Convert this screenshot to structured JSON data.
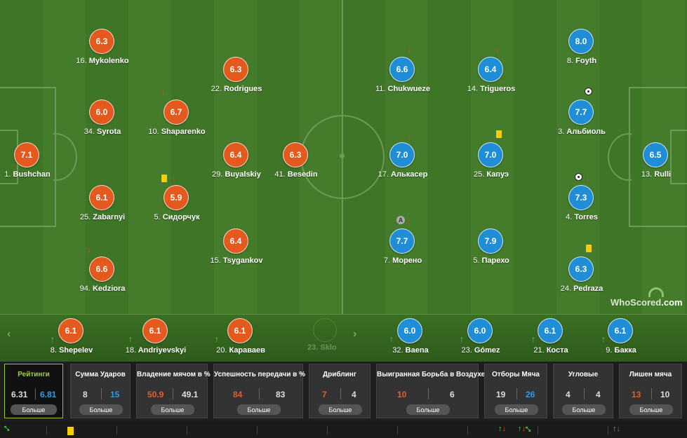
{
  "home_team": {
    "color": "#e4591d",
    "players": [
      {
        "rating": "6.3",
        "num": "16.",
        "name": "Mykolenko"
      },
      {
        "rating": "6.0",
        "num": "34.",
        "name": "Syrota"
      },
      {
        "rating": "6.1",
        "num": "25.",
        "name": "Zabarnyi"
      },
      {
        "rating": "6.6",
        "num": "94.",
        "name": "Kedziora"
      },
      {
        "rating": "6.7",
        "num": "10.",
        "name": "Shaparenko"
      },
      {
        "rating": "5.9",
        "num": "5.",
        "name": "Сидорчук"
      },
      {
        "rating": "6.3",
        "num": "22.",
        "name": "Rodrigues"
      },
      {
        "rating": "6.4",
        "num": "29.",
        "name": "Buyalskiy"
      },
      {
        "rating": "6.4",
        "num": "15.",
        "name": "Tsygankov"
      },
      {
        "rating": "6.3",
        "num": "41.",
        "name": "Besedin"
      },
      {
        "rating": "7.1",
        "num": "1.",
        "name": "Bushchan"
      }
    ],
    "subs": [
      {
        "rating": "6.1",
        "num": "8.",
        "name": "Shepelev"
      },
      {
        "rating": "6.1",
        "num": "18.",
        "name": "Andriyevskyi"
      },
      {
        "rating": "6.1",
        "num": "20.",
        "name": "Караваев"
      }
    ]
  },
  "away_team": {
    "color": "#1f8ed6",
    "players": [
      {
        "rating": "6.6",
        "num": "11.",
        "name": "Chukwueze"
      },
      {
        "rating": "7.0",
        "num": "17.",
        "name": "Алькасер"
      },
      {
        "rating": "7.7",
        "num": "7.",
        "name": "Морено"
      },
      {
        "rating": "6.4",
        "num": "14.",
        "name": "Trigueros"
      },
      {
        "rating": "7.0",
        "num": "25.",
        "name": "Капуэ"
      },
      {
        "rating": "7.9",
        "num": "5.",
        "name": "Парехо"
      },
      {
        "rating": "8.0",
        "num": "8.",
        "name": "Foyth"
      },
      {
        "rating": "7.7",
        "num": "3.",
        "name": "Альбиоль"
      },
      {
        "rating": "7.3",
        "num": "4.",
        "name": "Torres"
      },
      {
        "rating": "6.3",
        "num": "24.",
        "name": "Pedraza"
      },
      {
        "rating": "6.5",
        "num": "13.",
        "name": "Rulli"
      }
    ],
    "subs": [
      {
        "rating": "6.0",
        "num": "32.",
        "name": "Baena"
      },
      {
        "rating": "6.0",
        "num": "23.",
        "name": "Gómez"
      },
      {
        "rating": "6.1",
        "num": "21.",
        "name": "Коста"
      },
      {
        "rating": "6.1",
        "num": "9.",
        "name": "Бакка"
      }
    ]
  },
  "partial_sub": {
    "num": "23.",
    "name": "Sklo"
  },
  "logo": {
    "text": "WhoScored",
    "suffix": ".com"
  },
  "nav": {
    "prev": "‹",
    "next": "›"
  },
  "marks": {
    "arrow_down": "↓",
    "arrow_up": "↑",
    "captain": "A"
  },
  "stats": [
    {
      "title": "Рейтинги",
      "home": "6.31",
      "away": "6.81",
      "more": "Больше",
      "active": true
    },
    {
      "title": "Сумма Ударов",
      "home": "8",
      "away": "15",
      "more": "Больше"
    },
    {
      "title": "Владение мячом в %",
      "home": "50.9",
      "away": "49.1",
      "more": "Больше"
    },
    {
      "title": "Успешность передачи в %",
      "home": "84",
      "away": "83",
      "more": "Больше"
    },
    {
      "title": "Дриблинг",
      "home": "7",
      "away": "4",
      "more": "Больше"
    },
    {
      "title": "Выигранная Борьба в Воздухе",
      "home": "10",
      "away": "6",
      "more": "Больше"
    },
    {
      "title": "Отборы Мяча",
      "home": "19",
      "away": "26",
      "more": "Больше"
    },
    {
      "title": "Угловые",
      "home": "4",
      "away": "4",
      "more": "Больше"
    },
    {
      "title": "Лишен мяча",
      "home": "13",
      "away": "10",
      "more": "Больше"
    }
  ]
}
